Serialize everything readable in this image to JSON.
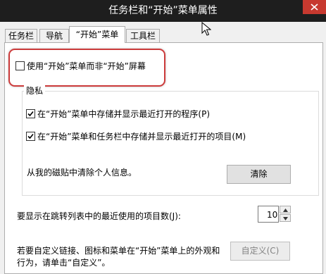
{
  "window": {
    "title": "任务栏和“开始”菜单属性"
  },
  "tabs": [
    {
      "label": "任务栏",
      "active": false
    },
    {
      "label": "导航",
      "active": false
    },
    {
      "label": "“开始”菜单",
      "active": true
    },
    {
      "label": "工具栏",
      "active": false
    }
  ],
  "start_screen_option": {
    "label": "使用“开始”菜单而非“开始”屏幕",
    "checked": false
  },
  "privacy": {
    "title": "隐私",
    "options": [
      {
        "label": "在“开始”菜单中存储并显示最近打开的程序(P)",
        "checked": true
      },
      {
        "label": "在“开始”菜单和任务栏中存储并显示最近打开的项目(M)",
        "checked": true
      }
    ],
    "clear_text": "从我的磁贴中清除个人信息。",
    "clear_button": "清除"
  },
  "recent_items": {
    "label": "要显示在跳转列表中的最近使用的项目数(J):",
    "value": "10"
  },
  "customize": {
    "line1": "若要自定义链接、图标和菜单在“开始”菜单上的外观和",
    "line2": "行为，请单击“自定义”。",
    "button": "自定义(C)"
  },
  "colors": {
    "highlight": "#cc3b3b",
    "close": "#c7392f",
    "titlebar": "#1e1e1e"
  },
  "icons": {
    "close": "close-icon",
    "cursor": "mouse-pointer-icon",
    "check": "checkmark-icon"
  }
}
